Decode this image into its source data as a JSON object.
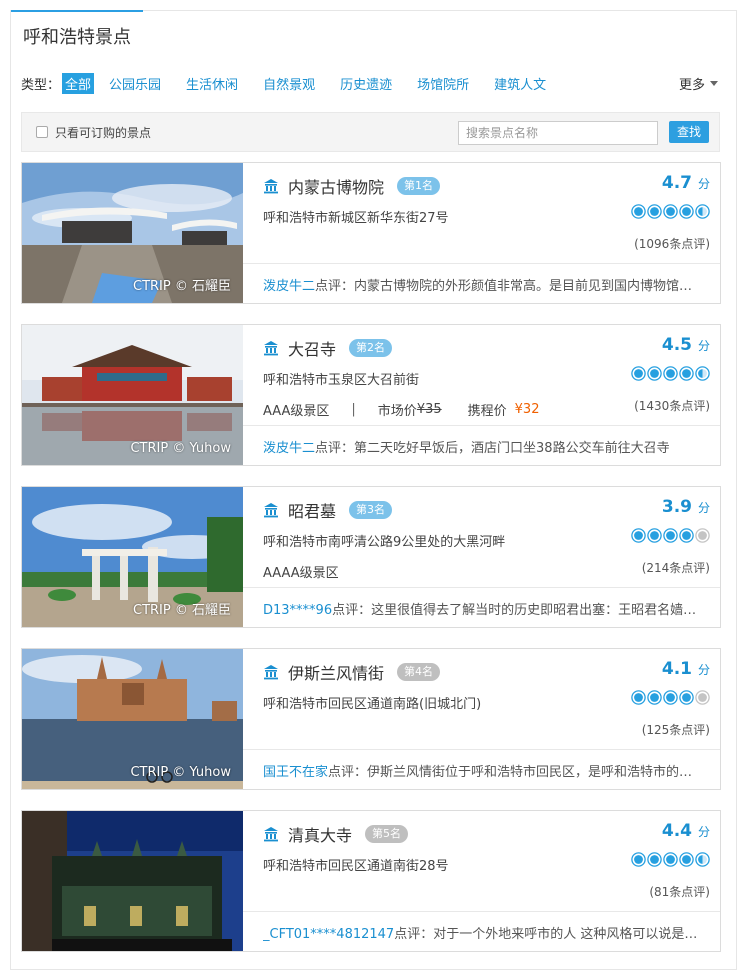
{
  "page": {
    "title": "呼和浩特景点"
  },
  "filters": {
    "type_label": "类型：",
    "chips": [
      "全部",
      "公园乐园",
      "生活休闲",
      "自然景观",
      "历史遗迹",
      "场馆院所",
      "建筑人文"
    ],
    "more_label": "更多"
  },
  "search": {
    "bookable_label": "只看可订购的景点",
    "placeholder": "搜索景点名称",
    "button_label": "查找"
  },
  "spots": [
    {
      "name": "内蒙古博物院",
      "rank": "第1名",
      "address": "呼和浩特市新城区新华东街27号",
      "level": "",
      "market_price_label": "",
      "market_price": "",
      "ctrip_price_label": "",
      "ctrip_price": "",
      "score": "4.7",
      "score_unit": "分",
      "stars": 4.5,
      "reviews": "(1096条点评)",
      "comment_user": "泼皮牛二",
      "comment_verb": "点评：",
      "comment_text": "内蒙古博物院的外形颜值非常高。是目前见到国内博物馆中最漂亮的",
      "watermark": "CTRIP © 石耀臣",
      "rank_style": "blue",
      "image": "museum"
    },
    {
      "name": "大召寺",
      "rank": "第2名",
      "address": "呼和浩特市玉泉区大召前街",
      "level": "AAA级景区",
      "market_price_label": "市场价",
      "market_price": "¥35",
      "ctrip_price_label": "携程价",
      "ctrip_price": "¥32",
      "score": "4.5",
      "score_unit": "分",
      "stars": 4.5,
      "reviews": "(1430条点评)",
      "comment_user": "泼皮牛二",
      "comment_verb": "点评：",
      "comment_text": "第二天吃好早饭后，酒店门口坐38路公交车前往大召寺",
      "watermark": "CTRIP © Yuhow",
      "rank_style": "blue",
      "image": "temple"
    },
    {
      "name": "昭君墓",
      "rank": "第3名",
      "address": "呼和浩特市南呼清公路9公里处的大黑河畔",
      "level": "AAAA级景区",
      "market_price_label": "",
      "market_price": "",
      "ctrip_price_label": "",
      "ctrip_price": "",
      "score": "3.9",
      "score_unit": "分",
      "stars": 4,
      "reviews": "(214条点评)",
      "comment_user": "D13****96",
      "comment_verb": "点评：",
      "comment_text": "这里很值得去了解当时的历史即昭君出塞：王昭君名嫱字昭君",
      "watermark": "CTRIP © 石耀臣",
      "rank_style": "blue",
      "image": "tomb"
    },
    {
      "name": "伊斯兰风情街",
      "rank": "第4名",
      "address": "呼和浩特市回民区通道南路(旧城北门)",
      "level": "",
      "market_price_label": "",
      "market_price": "",
      "ctrip_price_label": "",
      "ctrip_price": "",
      "score": "4.1",
      "score_unit": "分",
      "stars": 4,
      "reviews": "(125条点评)",
      "comment_user": "国王不在家",
      "comment_verb": "点评：",
      "comment_text": "伊斯兰风情街位于呼和浩特市回民区，是呼和浩特市的一条特色街",
      "watermark": "CTRIP © Yuhow",
      "rank_style": "grey",
      "image": "street"
    },
    {
      "name": "清真大寺",
      "rank": "第5名",
      "address": "呼和浩特市回民区通道南街28号",
      "level": "",
      "market_price_label": "",
      "market_price": "",
      "ctrip_price_label": "",
      "ctrip_price": "",
      "score": "4.4",
      "score_unit": "分",
      "stars": 4.5,
      "reviews": "(81条点评)",
      "comment_user": "_CFT01****4812147",
      "comment_verb": "点评：",
      "comment_text": "对于一个外地来呼市的人 这种风格可以说是很新奇了",
      "watermark": "",
      "rank_style": "grey",
      "image": "mosque"
    }
  ],
  "colors": {
    "accent": "#2b9fe3",
    "link": "#1a8fd0",
    "price": "#f06000",
    "rank_blue": "#7cc2ea",
    "rank_grey": "#bfbfbf"
  },
  "icons": {
    "spot_type": "building-icon",
    "star": "circle-star-icon",
    "more": "caret-down-icon"
  }
}
